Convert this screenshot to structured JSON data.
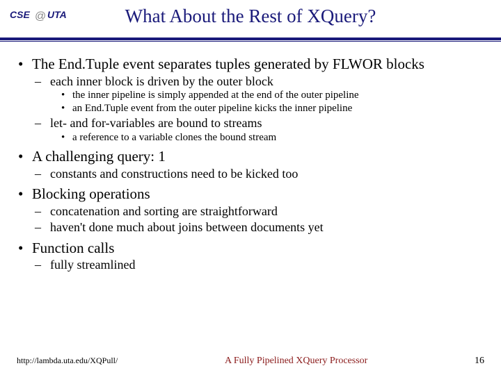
{
  "logo": {
    "cse": "CSE",
    "uta": "UTA"
  },
  "title": "What About the Rest of XQuery?",
  "bullets": {
    "b1": "The End.Tuple event separates tuples generated by FLWOR blocks",
    "b1a": "each inner block is driven by the outer block",
    "b1a1": "the inner pipeline is simply appended at the end of the outer pipeline",
    "b1a2": "an End.Tuple event from the outer pipeline kicks the inner pipeline",
    "b1b": "let- and for-variables are bound to streams",
    "b1b1": "a reference to a variable clones the bound stream",
    "b2": "A challenging query:     1",
    "b2a": "constants and constructions need to be kicked too",
    "b3": "Blocking operations",
    "b3a": "concatenation and sorting are straightforward",
    "b3b": "haven't done much about joins between documents yet",
    "b4": "Function calls",
    "b4a": "fully streamlined"
  },
  "footer": {
    "left": "http://lambda.uta.edu/XQPull/",
    "center": "A Fully Pipelined XQuery Processor",
    "right": "16"
  }
}
